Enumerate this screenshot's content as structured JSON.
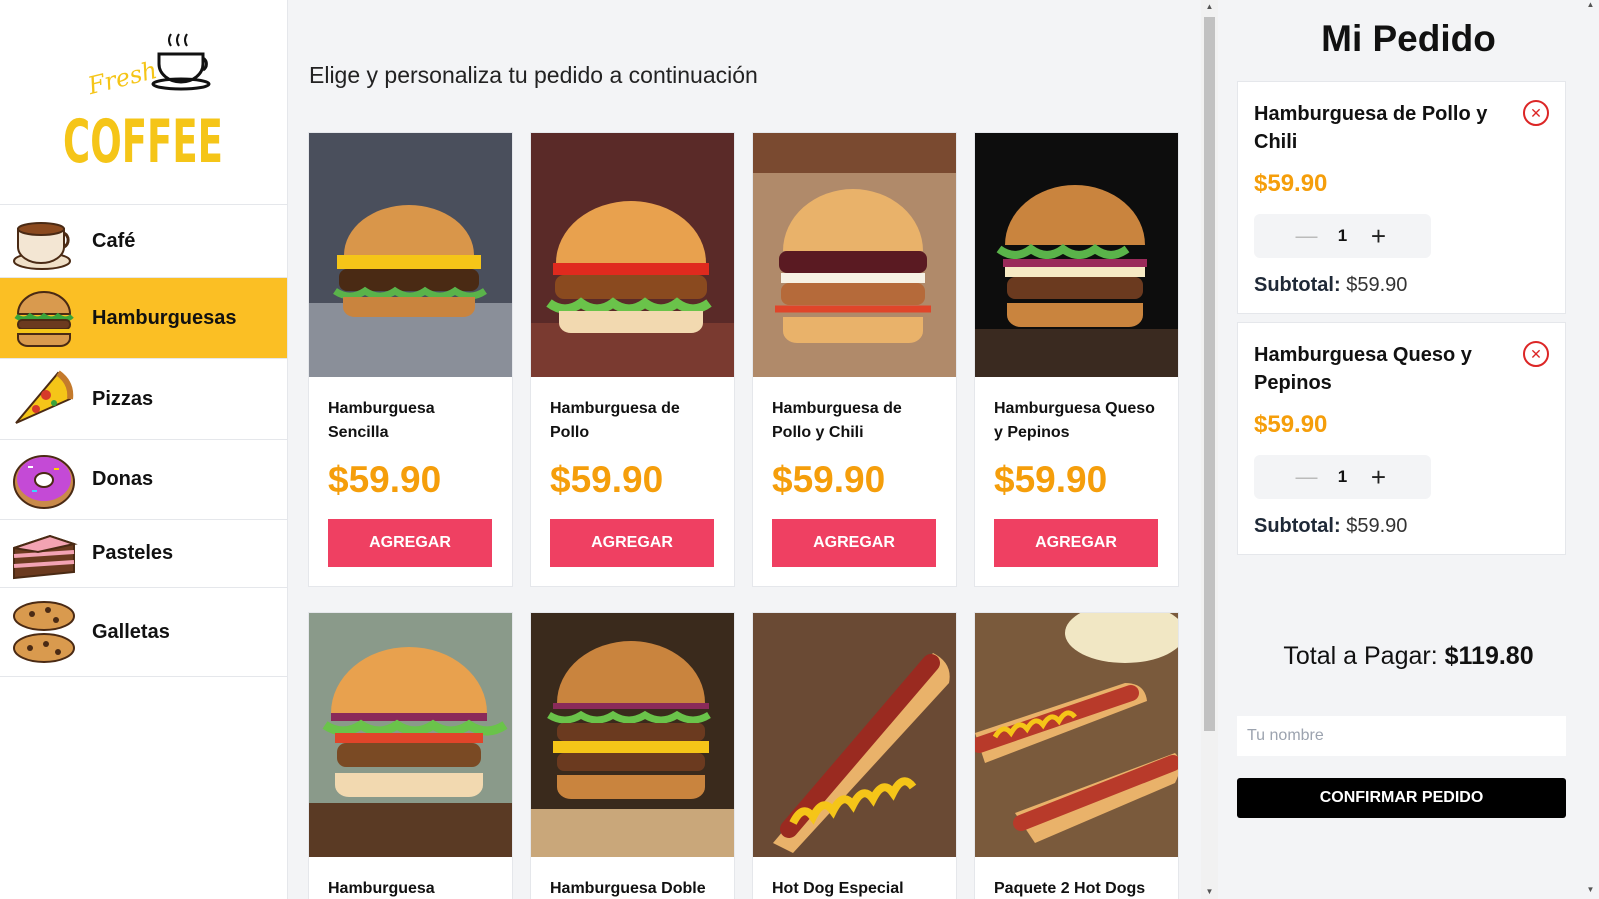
{
  "logo": {
    "word_top": "Fresh",
    "word_main": "COFFEE"
  },
  "categories": [
    {
      "label": "Café",
      "icon": "coffee-cup-icon",
      "active": false
    },
    {
      "label": "Hamburguesas",
      "icon": "burger-icon",
      "active": true
    },
    {
      "label": "Pizzas",
      "icon": "pizza-icon",
      "active": false
    },
    {
      "label": "Donas",
      "icon": "donut-icon",
      "active": false
    },
    {
      "label": "Pasteles",
      "icon": "cake-icon",
      "active": false
    },
    {
      "label": "Galletas",
      "icon": "cookie-icon",
      "active": false
    }
  ],
  "main": {
    "heading": "Elige y personaliza tu pedido a continuación",
    "products": [
      {
        "name": "Hamburguesa Sencilla",
        "price": "$59.90",
        "button": "AGREGAR"
      },
      {
        "name": "Hamburguesa de Pollo",
        "price": "$59.90",
        "button": "AGREGAR"
      },
      {
        "name": "Hamburguesa de Pollo y Chili",
        "price": "$59.90",
        "button": "AGREGAR"
      },
      {
        "name": "Hamburguesa Queso y Pepinos",
        "price": "$59.90",
        "button": "AGREGAR"
      },
      {
        "name": "Hamburguesa",
        "price": "",
        "button": ""
      },
      {
        "name": "Hamburguesa Doble",
        "price": "",
        "button": ""
      },
      {
        "name": "Hot Dog Especial",
        "price": "",
        "button": ""
      },
      {
        "name": "Paquete 2 Hot Dogs",
        "price": "",
        "button": ""
      }
    ]
  },
  "order": {
    "title": "Mi Pedido",
    "items": [
      {
        "name": "Hamburguesa de Pollo y Chili",
        "price": "$59.90",
        "qty": "1",
        "subtotal_label": "Subtotal:",
        "subtotal": "$59.90"
      },
      {
        "name": "Hamburguesa Queso y Pepinos",
        "price": "$59.90",
        "qty": "1",
        "subtotal_label": "Subtotal:",
        "subtotal": "$59.90"
      }
    ],
    "total_label": "Total a Pagar:",
    "total": "$119.80",
    "name_placeholder": "Tu nombre",
    "confirm": "CONFIRMAR PEDIDO"
  },
  "colors": {
    "accent": "#fbbf24",
    "price": "#f59e0b",
    "button": "#ef4062"
  }
}
